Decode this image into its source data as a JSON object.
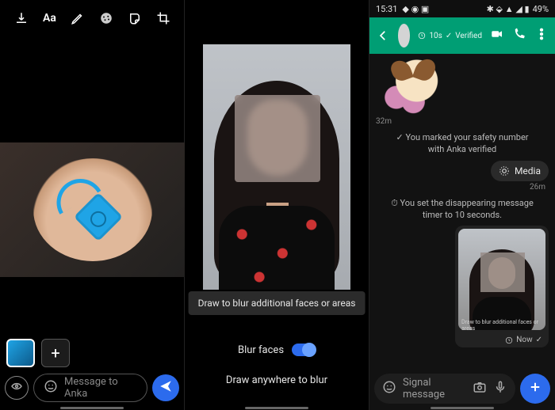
{
  "pane1": {
    "toolbar": {
      "save": "save-icon",
      "text": "Aa",
      "draw": "pen-icon",
      "blur": "blur-icon",
      "sticker": "sticker-icon",
      "crop": "crop-icon",
      "undo": "undo-icon",
      "done": "done-icon"
    },
    "add_media_plus": "+",
    "view_once_label": "∞",
    "composer": {
      "placeholder": "Message to Anka"
    },
    "send_label": "send"
  },
  "pane2": {
    "toast": "Draw to blur additional faces or areas",
    "blur_faces_label": "Blur faces",
    "blur_faces_enabled": true,
    "draw_anywhere_label": "Draw anywhere to blur"
  },
  "pane3": {
    "status": {
      "time": "15:31",
      "battery": "49%"
    },
    "header": {
      "name": "",
      "timer": "10s",
      "verified": "Verified"
    },
    "messages": {
      "sticker_time": "32m",
      "safety_text": "You marked your safety number with Anka verified",
      "media_chip": "Media",
      "media_time": "26m",
      "timer_text": "You set the disappearing message timer to 10 seconds.",
      "image_caption": "Draw to blur additional faces or areas",
      "image_time": "Now"
    },
    "composer": {
      "placeholder": "Signal message"
    }
  }
}
